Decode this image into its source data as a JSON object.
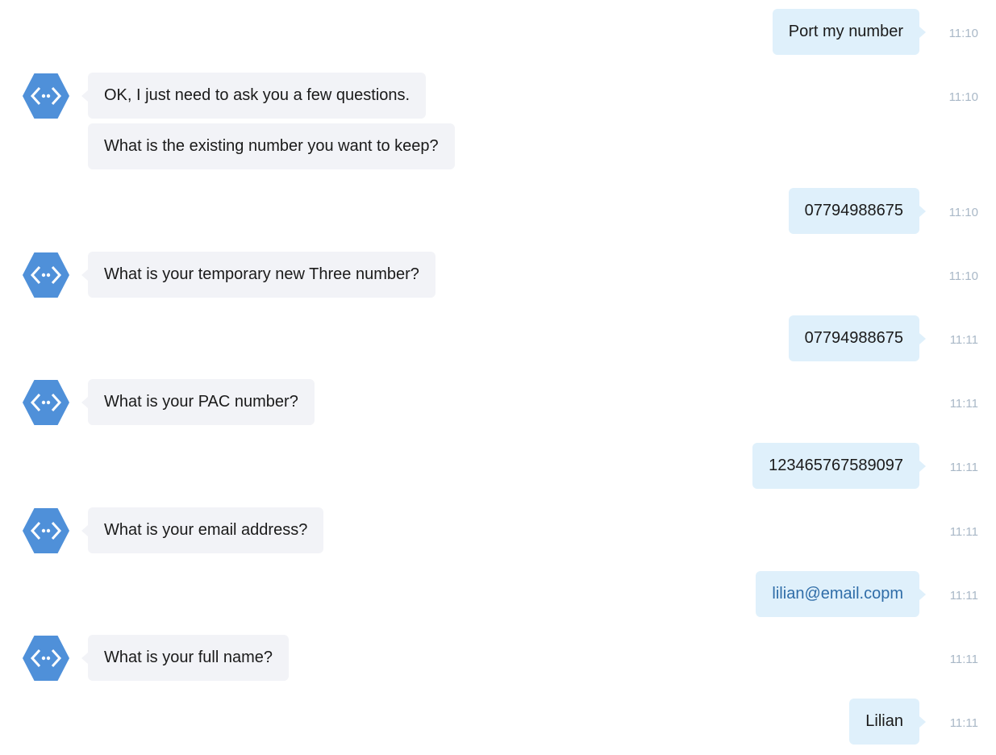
{
  "conversation": {
    "messages": [
      {
        "sender": "user",
        "text": "Port my number",
        "time": "11:10"
      },
      {
        "sender": "bot",
        "text": "OK, I just need to ask you a few questions.",
        "time": "11:10"
      },
      {
        "sender": "bot",
        "text": "What is the existing number you want to keep?",
        "time": ""
      },
      {
        "sender": "user",
        "text": "07794988675",
        "time": "11:10"
      },
      {
        "sender": "bot",
        "text": "What is your temporary new Three number?",
        "time": "11:10"
      },
      {
        "sender": "user",
        "text": "07794988675",
        "time": "11:11"
      },
      {
        "sender": "bot",
        "text": "What is your PAC number?",
        "time": "11:11"
      },
      {
        "sender": "user",
        "text": "123465767589097",
        "time": "11:11"
      },
      {
        "sender": "bot",
        "text": "What is your email address?",
        "time": "11:11"
      },
      {
        "sender": "user",
        "text": "lilian@email.copm",
        "time": "11:11"
      },
      {
        "sender": "bot",
        "text": "What is your full name?",
        "time": "11:11"
      },
      {
        "sender": "user",
        "text": "Lilian",
        "time": "11:11"
      }
    ]
  },
  "theme": {
    "user_bubble_color": "#dff0fb",
    "bot_bubble_color": "#f2f3f7",
    "avatar_color": "#4f90d9",
    "link_color": "#2f6da8",
    "time_color": "#a9b8c7"
  },
  "icons": {
    "bot_avatar": "hexagon-code-brackets-icon"
  }
}
